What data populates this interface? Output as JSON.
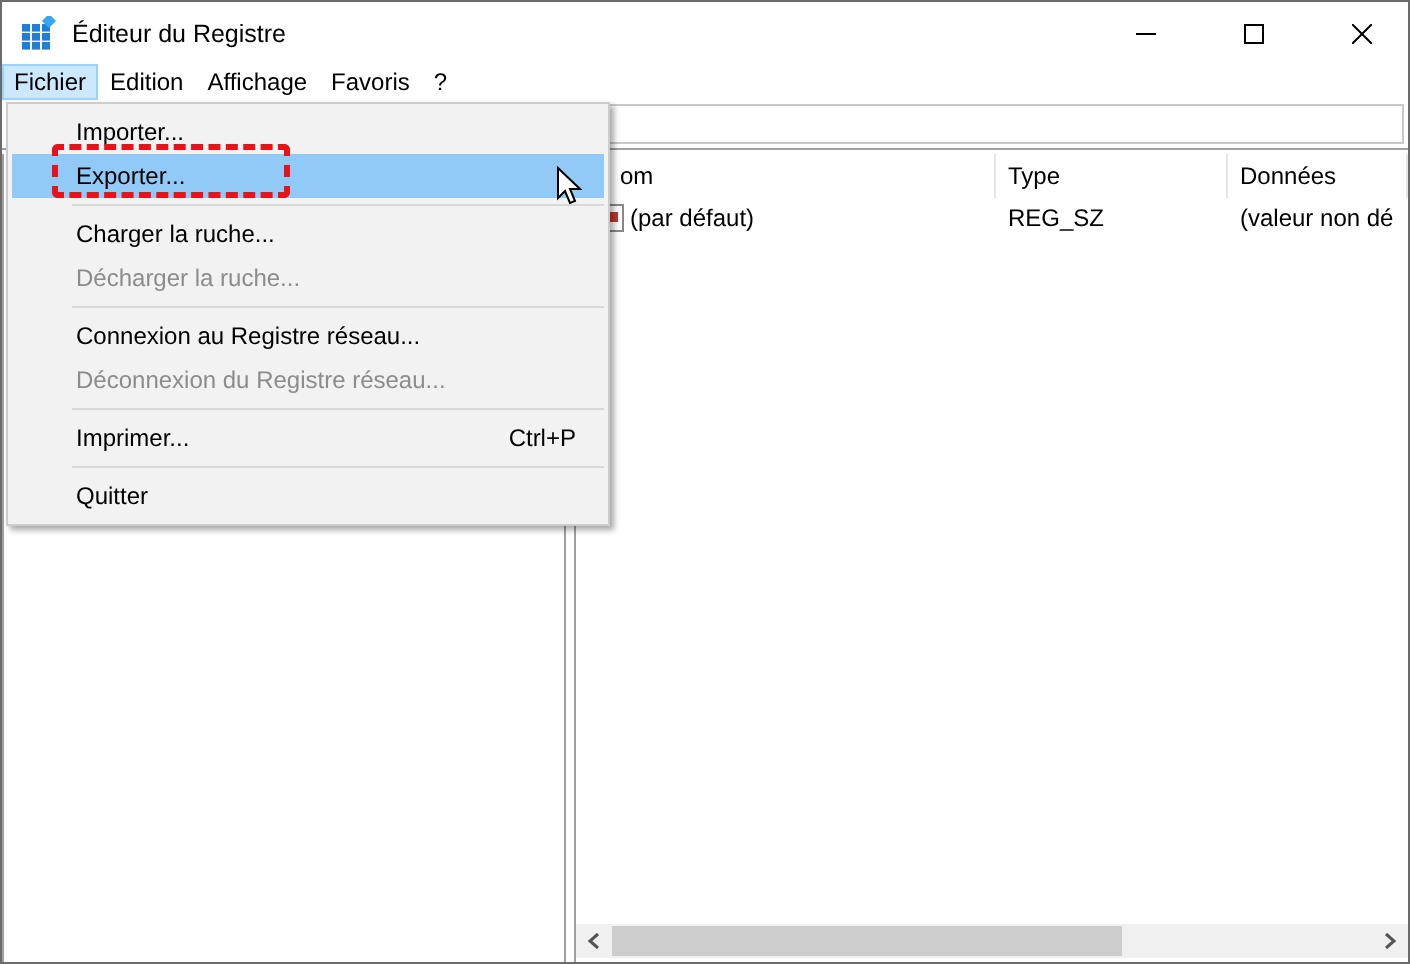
{
  "window": {
    "title": "Éditeur du Registre"
  },
  "menubar": [
    {
      "label": "Fichier",
      "selected": true
    },
    {
      "label": "Edition",
      "selected": false
    },
    {
      "label": "Affichage",
      "selected": false
    },
    {
      "label": "Favoris",
      "selected": false
    },
    {
      "label": "?",
      "selected": false
    }
  ],
  "menu": [
    {
      "kind": "item",
      "label": "Importer...",
      "disabled": false,
      "selected": false
    },
    {
      "kind": "item",
      "label": "Exporter...",
      "disabled": false,
      "selected": true
    },
    {
      "kind": "separator"
    },
    {
      "kind": "item",
      "label": "Charger la ruche...",
      "disabled": false,
      "selected": false
    },
    {
      "kind": "item",
      "label": "Décharger la ruche...",
      "disabled": true,
      "selected": false
    },
    {
      "kind": "separator"
    },
    {
      "kind": "item",
      "label": "Connexion au Registre réseau...",
      "disabled": false,
      "selected": false
    },
    {
      "kind": "item",
      "label": "Déconnexion du Registre réseau...",
      "disabled": true,
      "selected": false
    },
    {
      "kind": "separator"
    },
    {
      "kind": "item",
      "label": "Imprimer...",
      "shortcut": "Ctrl+P",
      "disabled": false,
      "selected": false
    },
    {
      "kind": "separator"
    },
    {
      "kind": "item",
      "label": "Quitter",
      "disabled": false,
      "selected": false
    }
  ],
  "values_table": {
    "columns": [
      "om",
      "Type",
      "Données"
    ],
    "rows": [
      {
        "cells": [
          "(par défaut)",
          "REG_SZ",
          "(valeur non dé"
        ]
      }
    ]
  }
}
